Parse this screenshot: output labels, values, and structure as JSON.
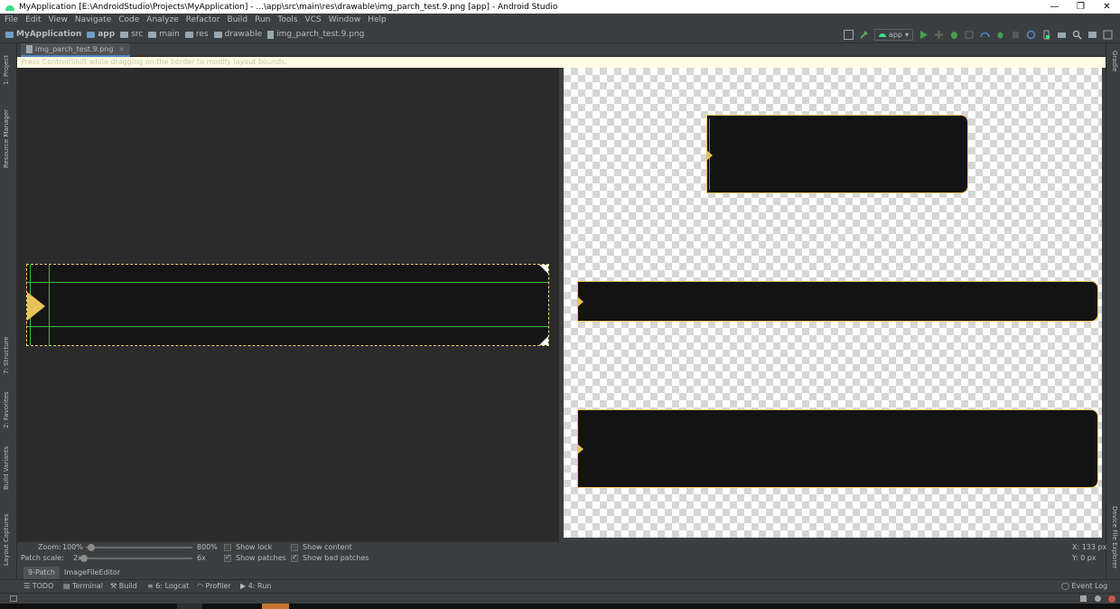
{
  "window": {
    "title": "MyApplication [E:\\AndroidStudio\\Projects\\MyApplication] - ...\\app\\src\\main\\res\\drawable\\img_parch_test.9.png [app] - Android Studio",
    "minimize": "—",
    "maximize": "❐",
    "close": "✕"
  },
  "menu": [
    "File",
    "Edit",
    "View",
    "Navigate",
    "Code",
    "Analyze",
    "Refactor",
    "Build",
    "Run",
    "Tools",
    "VCS",
    "Window",
    "Help"
  ],
  "breadcrumbs": [
    "MyApplication",
    "app",
    "src",
    "main",
    "res",
    "drawable",
    "img_parch_test.9.png"
  ],
  "toolbar": {
    "run_config": "app"
  },
  "left_tool_tabs": [
    "1: Project",
    "Resource Manager",
    "7: Structure",
    "2: Favorites",
    "Build Variants",
    "Layout Captures"
  ],
  "right_tool_tabs": [
    "Gradle",
    "Device File Explorer"
  ],
  "editor_tab": {
    "label": "img_parch_test.9.png",
    "close": "×"
  },
  "hint": "Press Control/Shift while dragging on the border to modify layout bounds.",
  "controls": {
    "zoom_label": "Zoom:",
    "zoom_value": "100%",
    "zoom_max": "800%",
    "patch_scale_label": "Patch scale:",
    "patch_scale_value": "2x",
    "patch_scale_max": "6x",
    "show_lock": "Show lock",
    "show_patches": "Show patches",
    "show_content": "Show content",
    "show_bad_patches": "Show bad patches",
    "show_lock_checked": false,
    "show_patches_checked": true,
    "show_content_checked": false,
    "show_bad_patches_checked": true,
    "coord_x": "X: 133 px",
    "coord_y": "Y:    0 px"
  },
  "subtabs": [
    "9-Patch",
    "ImageFileEditor"
  ],
  "tool_windows": [
    "TODO",
    "Terminal",
    "Build",
    "6: Logcat",
    "Profiler",
    "4: Run"
  ],
  "event_log": "Event Log"
}
